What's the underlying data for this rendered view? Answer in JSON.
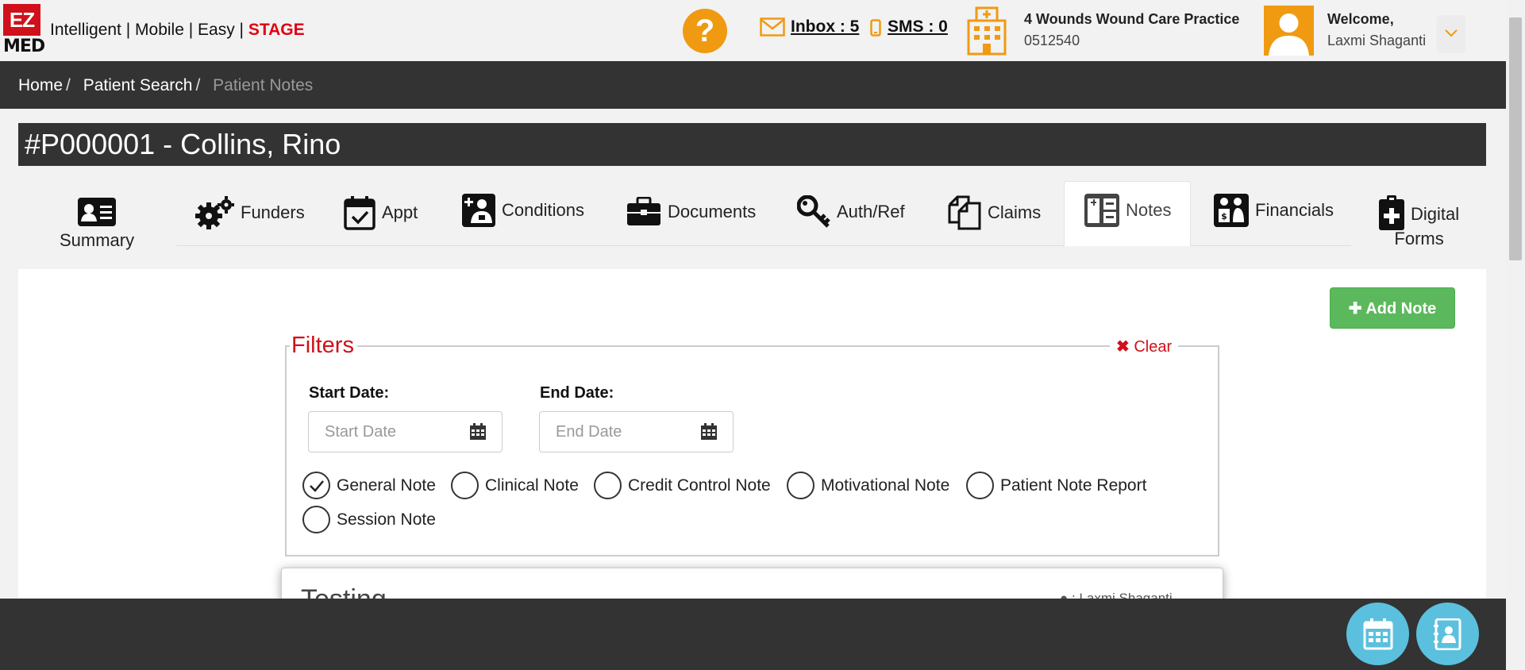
{
  "brand": {
    "logo_top": "EZ",
    "logo_bottom": "MED",
    "tagline": "Intelligent | Mobile | Easy | ",
    "env": "STAGE",
    "accent": "#d0111b"
  },
  "header": {
    "help_icon": "question-icon",
    "inbox_label": "Inbox : 5",
    "sms_label": "SMS : 0",
    "practice_name": "4 Wounds Wound Care Practice",
    "practice_code": "0512540",
    "welcome_label": "Welcome,",
    "user_name": "Laxmi Shaganti",
    "orange": "#f09a12"
  },
  "breadcrumb": {
    "items": [
      "Home",
      "Patient Search",
      "Patient Notes"
    ],
    "separator": "/"
  },
  "patient": {
    "title": "#P000001 - Collins, Rino"
  },
  "tabs": [
    {
      "label": "Summary",
      "icon": "id-card-icon"
    },
    {
      "label": "Funders",
      "icon": "gears-icon"
    },
    {
      "label": "Appt",
      "icon": "calendar-check-icon"
    },
    {
      "label": "Conditions",
      "icon": "medical-person-icon"
    },
    {
      "label": "Documents",
      "icon": "briefcase-icon"
    },
    {
      "label": "Auth/Ref",
      "icon": "key-icon"
    },
    {
      "label": "Claims",
      "icon": "copy-icon"
    },
    {
      "label": "Notes",
      "icon": "notes-icon",
      "active": true
    },
    {
      "label": "Financials",
      "icon": "financials-icon"
    },
    {
      "label": "Digital",
      "label2": "Forms",
      "icon": "clipboard-plus-icon"
    }
  ],
  "actions": {
    "add_note": "Add Note",
    "add_note_color": "#5cb85c"
  },
  "filters": {
    "legend": "Filters",
    "clear": "Clear",
    "start_label": "Start Date:",
    "start_placeholder": "Start Date",
    "end_label": "End Date:",
    "end_placeholder": "End Date",
    "note_types": [
      {
        "label": "General Note",
        "checked": true
      },
      {
        "label": "Clinical Note",
        "checked": false
      },
      {
        "label": "Credit Control Note",
        "checked": false
      },
      {
        "label": "Motivational Note",
        "checked": false
      },
      {
        "label": "Patient Note Report",
        "checked": false
      },
      {
        "label": "Session Note",
        "checked": false
      }
    ]
  },
  "notes": [
    {
      "title": "Testing",
      "author": ": Laxmi Shaganti"
    }
  ],
  "footer": {
    "fab1_icon": "calendar-icon",
    "fab2_icon": "contact-book-icon",
    "fab_color": "#5bc0de"
  }
}
